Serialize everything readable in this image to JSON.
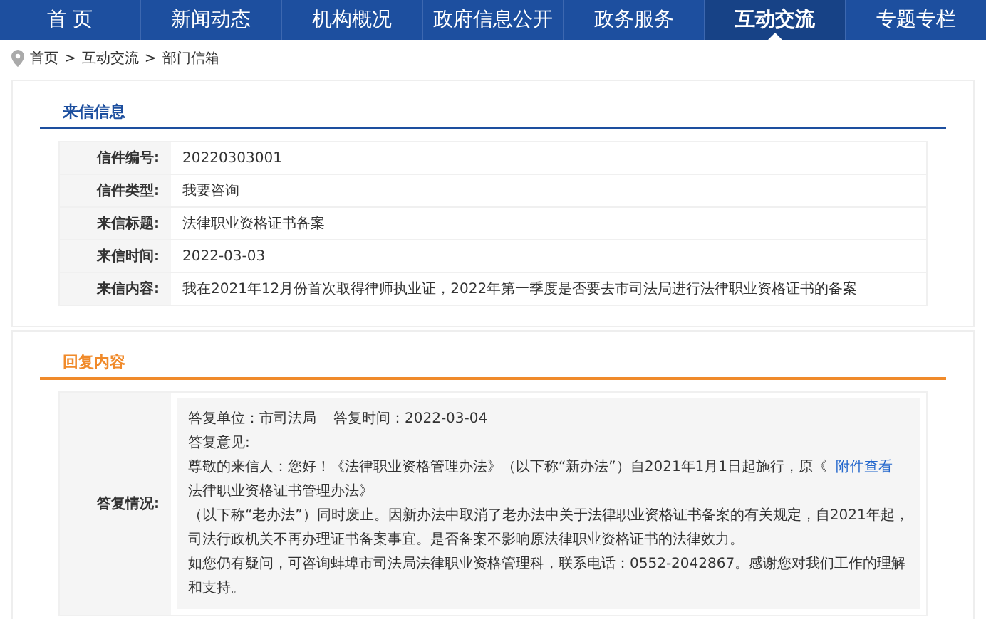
{
  "nav": [
    {
      "label": "首 页",
      "selected": false
    },
    {
      "label": "新闻动态",
      "selected": false
    },
    {
      "label": "机构概况",
      "selected": false
    },
    {
      "label": "政府信息公开",
      "selected": false
    },
    {
      "label": "政务服务",
      "selected": false
    },
    {
      "label": "互动交流",
      "selected": true
    },
    {
      "label": "专题专栏",
      "selected": false
    }
  ],
  "breadcrumb": [
    "首页",
    "互动交流",
    "部门信箱"
  ],
  "breadcrumb_separator": ">",
  "letter": {
    "title": "来信信息",
    "rows": [
      {
        "label": "信件编号:",
        "value": "20220303001"
      },
      {
        "label": "信件类型:",
        "value": "我要咨询"
      },
      {
        "label": "来信标题:",
        "value": "法律职业资格证书备案"
      },
      {
        "label": "来信时间:",
        "value": "2022-03-03"
      },
      {
        "label": "来信内容:",
        "value": "我在2021年12月份首次取得律师执业证，2022年第一季度是否要去市司法局进行法律职业资格证书的备案"
      }
    ]
  },
  "reply": {
    "title": "回复内容",
    "label": "答复情况:",
    "unit": "答复单位：市司法局",
    "time": "答复时间：2022-03-04",
    "opinion_label": "答复意见:",
    "lines": [
      {
        "text": "尊敬的来信人：您好！《法律职业资格管理办法》（以下称“新办法”）自2021年1月1日起施行，原《",
        "link": "附件查看"
      },
      {
        "text": "法律职业资格证书管理办法》"
      },
      {
        "text": "（以下称“老办法”）同时废止。因新办法中取消了老办法中关于法律职业资格证书备案的有关规定，自2021年起，司法行政机关不再办理证书备案事宜。是否备案不影响原法律职业资格证书的法律效力。"
      },
      {
        "text": "如您仍有疑问，可咨询蚌埠市司法局法律职业资格管理科，联系电话：0552-2042867。感谢您对我们工作的理解和支持。"
      }
    ]
  }
}
